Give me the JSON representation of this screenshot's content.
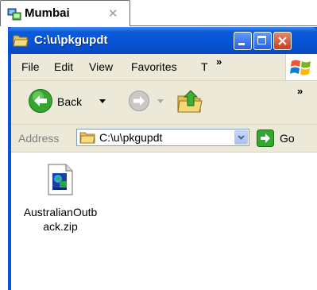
{
  "session": {
    "tab_label": "Mumbai",
    "close_glyph": "✕"
  },
  "window": {
    "title": "C:\\u\\pkgupdt",
    "icon": "folder-open-icon",
    "colors": {
      "titlebar": "#0752d6",
      "close_button": "#c4401f"
    }
  },
  "menubar": {
    "items": [
      "File",
      "Edit",
      "View",
      "Favorites",
      "T"
    ],
    "overflow": "»"
  },
  "toolbar": {
    "back_label": "Back",
    "overflow": "»"
  },
  "address": {
    "label": "Address",
    "value": "C:\\u\\pkgupdt",
    "go_label": "Go"
  },
  "files": [
    {
      "name": "AustralianOutback.zip",
      "icon": "zip-file-icon"
    }
  ]
}
